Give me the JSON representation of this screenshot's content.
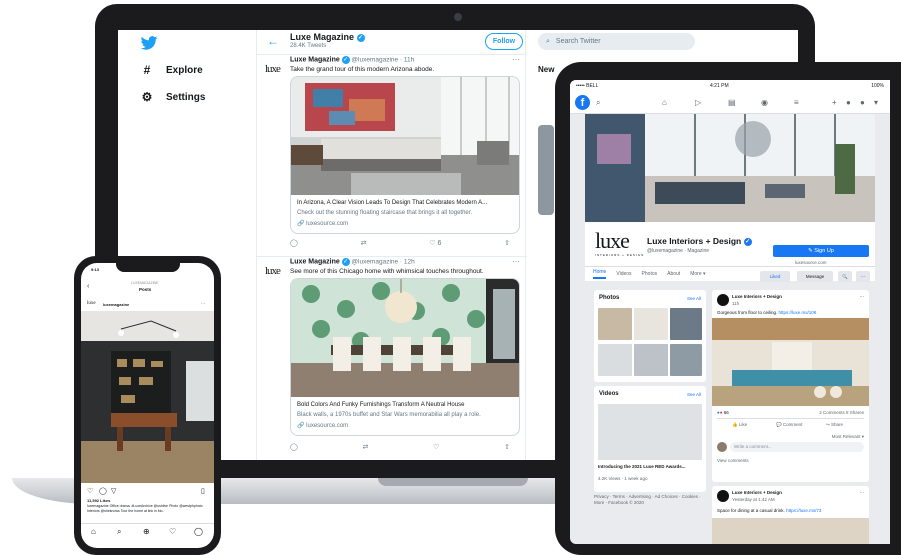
{
  "twitter": {
    "nav": [
      {
        "icon": "#",
        "label": "Explore"
      },
      {
        "icon": "⚙",
        "label": "Settings"
      }
    ],
    "header": {
      "title": "Luxe Magazine",
      "subtitle": "28.4K Tweets",
      "follow": "Follow"
    },
    "search_placeholder": "Search Twitter",
    "right_heading": "New",
    "tweets": [
      {
        "logo": "luxe",
        "name": "Luxe Magazine",
        "meta": "@luxemagazine · 11h",
        "text": "Take the grand tour of this modern Arizona abode.",
        "card_title": "In Arizona, A Clear Vision Leads To Design That Celebrates Modern A...",
        "card_desc": "Check out the stunning floating staircase that brings it all together.",
        "card_link": "luxesource.com",
        "likes": "6"
      },
      {
        "logo": "luxe",
        "name": "Luxe Magazine",
        "meta": "@luxemagazine · 12h",
        "text": "See more of this Chicago home with whimsical touches throughout.",
        "card_title": "Bold Colors And Funky Furnishings Transform A Neutral House",
        "card_desc": "Black walls, a 1970s buffet and Star Wars memorabilia all play a role.",
        "card_link": "luxesource.com",
        "likes": ""
      }
    ]
  },
  "ipad": {
    "status_left": "••••• BELL",
    "status_time": "4:21 PM",
    "status_right": "100%",
    "page_name": "Luxe Interiors + Design",
    "page_handle": "@luxemagazine · Magazine",
    "logo": "luxe",
    "logo_sub": "INTERIORS + DESIGN",
    "signup": "Sign Up",
    "site": "luxesource.com",
    "tabs": [
      "Home",
      "Videos",
      "Photos",
      "About",
      "More ▾"
    ],
    "tab_buttons": [
      "Liked",
      "Message",
      "🔍",
      "···"
    ],
    "photos_title": "Photos",
    "see_all": "See All",
    "videos_title": "Videos",
    "video_caption": "Introducing the 2021 Luxe RED Awards...",
    "video_meta": "4.2K Views · 1 week ago",
    "footer": "Privacy · Terms · Advertising · Ad Choices · Cookies · More · Facebook © 2020",
    "post1": {
      "name": "Luxe Interiors + Design",
      "time": "11h",
      "text": "Gorgeous from floor to ceiling.",
      "link": "https://luxe.ms/108",
      "reactions": "66",
      "comments": "2 Comments 8 Shares",
      "actions": [
        "Like",
        "Comment",
        "Share"
      ],
      "relevant": "Most Relevant ▾",
      "comment_placeholder": "Write a comment...",
      "view_comments": "View comments"
    },
    "post2": {
      "name": "Luxe Interiors + Design",
      "time": "Yesterday at 1:42 AM",
      "text": "Space for dining at a casual drink.",
      "link": "https://luxe.ms/73"
    }
  },
  "iphone": {
    "time": "9:13",
    "header_top": "LUXEMAGAZINE",
    "header_title": "Posts",
    "account": "luxemagazine",
    "likes": "11,592 Likes",
    "caption": "luxemagazine Office drama. #LuxeArchive @ushlive Photo @westphphoto Interiors @sheknows Tour the home at link in bio.",
    "tabs": [
      "⌂",
      "⌕",
      "⊕",
      "♡",
      "◯"
    ]
  }
}
